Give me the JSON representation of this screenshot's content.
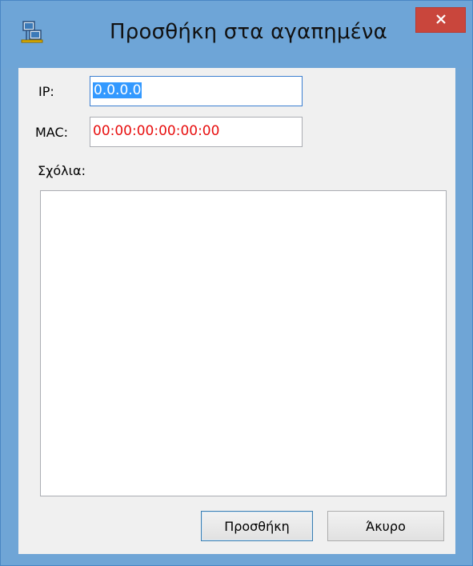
{
  "window": {
    "title": "Προσθήκη στα αγαπημένα",
    "icon": "network-computers-icon",
    "close_glyph": "✕"
  },
  "form": {
    "ip_label": "IP:",
    "ip_value": "0.0.0.0",
    "mac_label": "MAC:",
    "mac_value": "00:00:00:00:00:00",
    "comments_label": "Σχόλια:",
    "comments_value": ""
  },
  "buttons": {
    "add_label": "Προσθήκη",
    "cancel_label": "Άκυρο"
  },
  "colors": {
    "titlebar": "#6ea5d7",
    "close_button": "#c9463c",
    "mac_text": "#e81010",
    "selection": "#3399ff"
  }
}
